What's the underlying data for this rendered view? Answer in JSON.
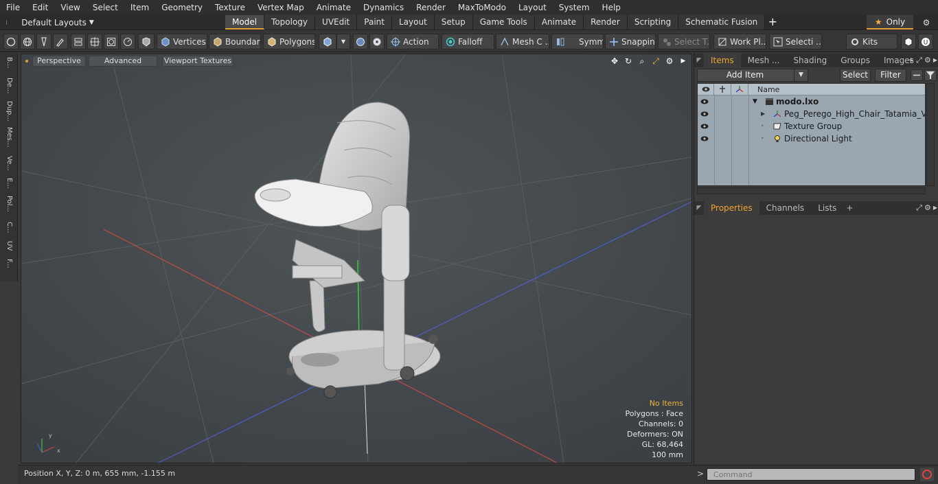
{
  "menu": [
    "File",
    "Edit",
    "View",
    "Select",
    "Item",
    "Geometry",
    "Texture",
    "Vertex Map",
    "Animate",
    "Dynamics",
    "Render",
    "MaxToModo",
    "Layout",
    "System",
    "Help"
  ],
  "layout_dropdown": "Default Layouts",
  "tabs": [
    "Model",
    "Topology",
    "UVEdit",
    "Paint",
    "Layout",
    "Setup",
    "Game Tools",
    "Animate",
    "Render",
    "Scripting",
    "Schematic Fusion"
  ],
  "active_tab": "Model",
  "only_label": "Only",
  "toolbar": {
    "vertices": "Vertices",
    "boundary": "Boundary",
    "polygons": "Polygons",
    "action": "Action",
    "action_more": "...",
    "falloff": "Falloff",
    "mesh": "Mesh C ...",
    "symm": "Symm ...",
    "snapping": "Snapping",
    "select_t": "Select T...",
    "work_pl": "Work Pl...",
    "selecti": "Selecti ...",
    "kits": "Kits"
  },
  "left_tabs": [
    "B...",
    "De...",
    "Dup...",
    "Mes...",
    "Ve...",
    "E...",
    "Pol...",
    "C...",
    "UV",
    "F..."
  ],
  "viewport": {
    "perspective": "Perspective",
    "advanced": "Advanced",
    "textures": "Viewport Textures",
    "info": {
      "items": "No Items",
      "polygons": "Polygons : Face",
      "channels": "Channels: 0",
      "deformers": "Deformers: ON",
      "gl": "GL: 68,464",
      "unit": "100 mm"
    }
  },
  "status": "Position X, Y, Z:   0 m, 655 mm, -1.155 m",
  "items_panel": {
    "tabs": [
      "Items",
      "Mesh ...",
      "Shading",
      "Groups",
      "Images"
    ],
    "add_item": "Add Item",
    "select": "Select",
    "filter": "Filter",
    "name_col": "Name",
    "rows": [
      {
        "label": "modo.lxo",
        "bold": true
      },
      {
        "label": "Peg_Perego_High_Chair_Tatamia_Vertic...",
        "bold": false
      },
      {
        "label": "Texture Group",
        "bold": false
      },
      {
        "label": "Directional Light",
        "bold": false
      }
    ]
  },
  "props_panel": {
    "tabs": [
      "Properties",
      "Channels",
      "Lists"
    ]
  },
  "command_placeholder": "Command",
  "colors": {
    "accent": "#e5a032",
    "tree_bg": "#9aa6b0",
    "viewport_bg": "#454a4e"
  }
}
